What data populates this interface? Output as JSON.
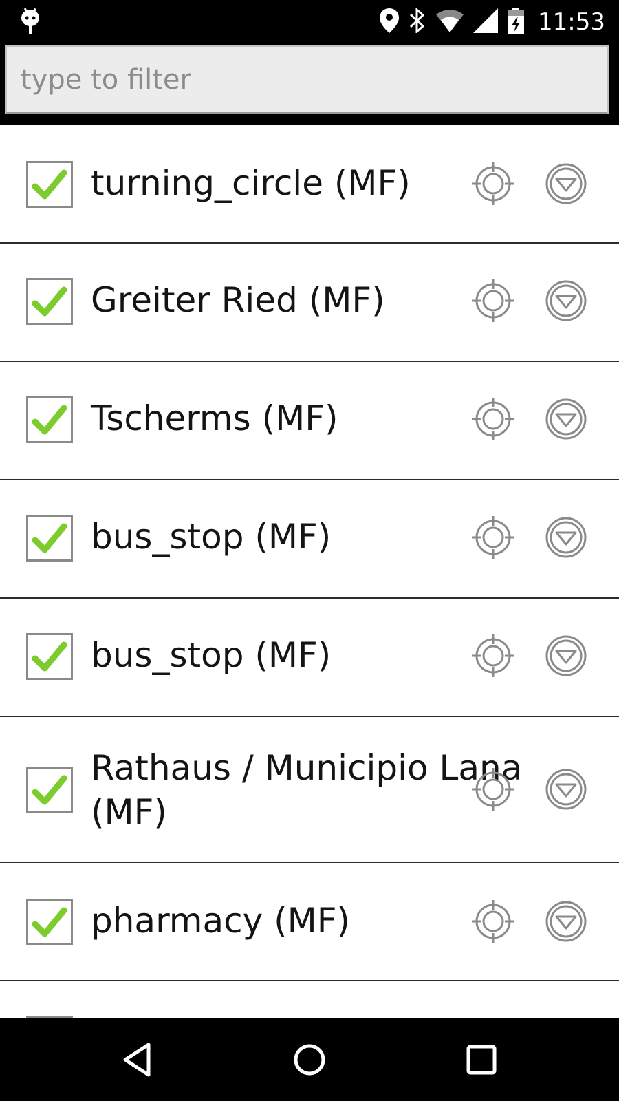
{
  "status_bar": {
    "time": "11:53",
    "icons": [
      "android-notification-icon",
      "location-pin-icon",
      "bluetooth-icon",
      "wifi-icon",
      "cell-signal-icon",
      "battery-charging-icon"
    ]
  },
  "filter": {
    "placeholder": "type to filter",
    "value": ""
  },
  "list": {
    "items": [
      {
        "label": "turning_circle (MF)",
        "checked": true
      },
      {
        "label": "Greiter Ried (MF)",
        "checked": true
      },
      {
        "label": "Tscherms (MF)",
        "checked": true
      },
      {
        "label": "bus_stop (MF)",
        "checked": true
      },
      {
        "label": "bus_stop (MF)",
        "checked": true
      },
      {
        "label": "Rathaus / Municipio Lana",
        "label_line2": "(MF)",
        "checked": true
      },
      {
        "label": "pharmacy (MF)",
        "checked": true
      },
      {
        "label": "",
        "checked": true
      }
    ]
  },
  "nav_bar": {
    "buttons": [
      "back-icon",
      "home-icon",
      "recents-icon"
    ]
  },
  "colors": {
    "check_green": "#7ccc2e",
    "bar_black": "#000000",
    "divider": "#2b2b2b"
  }
}
